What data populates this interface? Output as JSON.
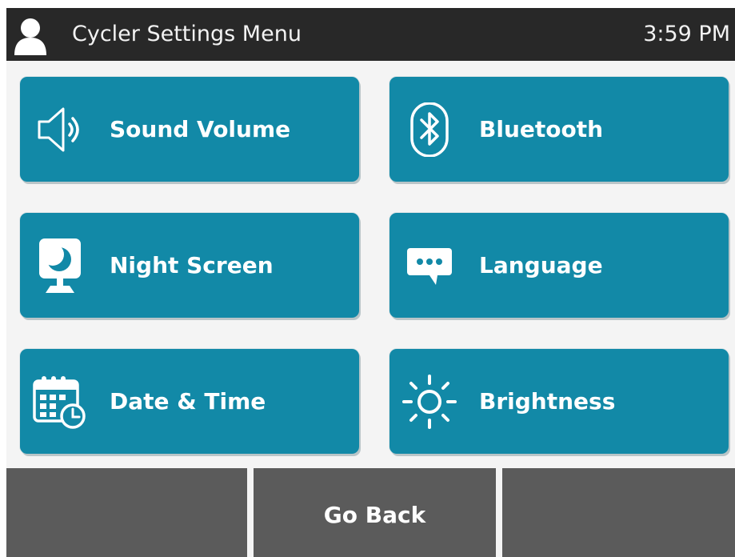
{
  "header": {
    "title": "Cycler Settings Menu",
    "time": "3:59 PM"
  },
  "tiles": [
    {
      "label": "Sound Volume",
      "icon": "speaker-icon"
    },
    {
      "label": "Bluetooth",
      "icon": "bluetooth-icon"
    },
    {
      "label": "Night Screen",
      "icon": "night-screen-icon"
    },
    {
      "label": "Language",
      "icon": "chat-bubble-icon"
    },
    {
      "label": "Date & Time",
      "icon": "calendar-clock-icon"
    },
    {
      "label": "Brightness",
      "icon": "sun-icon"
    }
  ],
  "footer": {
    "left_label": "",
    "back_label": "Go Back",
    "right_label": ""
  },
  "colors": {
    "header_bg": "#282828",
    "tile_bg": "#1289a7",
    "footer_bg": "#5b5b5b",
    "screen_bg": "#f4f4f4"
  }
}
